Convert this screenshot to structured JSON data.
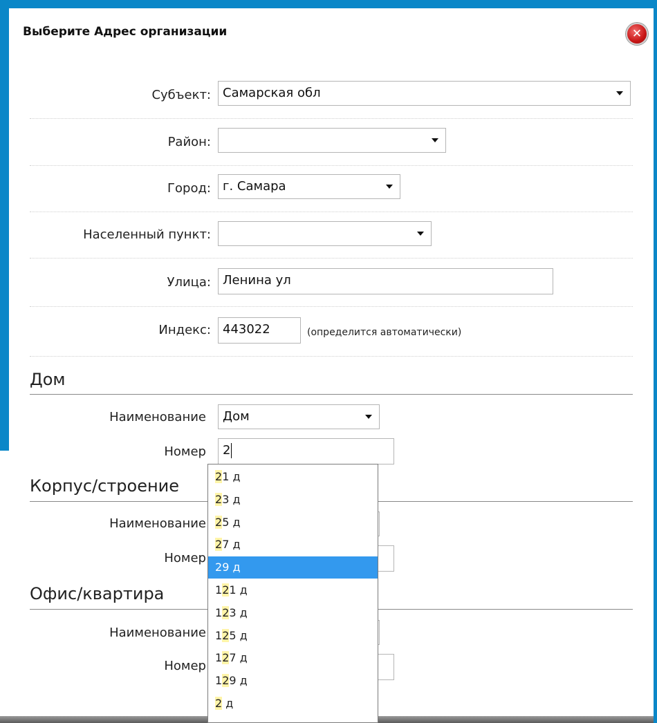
{
  "dialog": {
    "title": "Выберите Адрес организации",
    "close_icon": "close-icon"
  },
  "address": {
    "subject": {
      "label": "Субъект:",
      "value": "Самарская обл"
    },
    "district": {
      "label": "Район:",
      "value": ""
    },
    "city": {
      "label": "Город:",
      "value": "г. Самара"
    },
    "locality": {
      "label": "Населенный пункт:",
      "value": ""
    },
    "street": {
      "label": "Улица:",
      "value": "Ленина ул"
    },
    "index": {
      "label": "Индекс:",
      "value": "443022",
      "hint": "(определится автоматически)"
    }
  },
  "house": {
    "title": "Дом",
    "name_label": "Наименование",
    "name_value": "Дом",
    "number_label": "Номер",
    "number_value": "2"
  },
  "building": {
    "title": "Корпус/строение",
    "name_label": "Наименование",
    "number_label": "Номер"
  },
  "office": {
    "title": "Офис/квартира",
    "name_label": "Наименование",
    "number_label": "Номер"
  },
  "suggestions": {
    "items": [
      {
        "match": "2",
        "rest": "1 д"
      },
      {
        "match": "2",
        "rest": "3 д"
      },
      {
        "match": "2",
        "rest": "5 д"
      },
      {
        "match": "2",
        "rest": "7 д"
      },
      {
        "match": "2",
        "rest": "9 д"
      },
      {
        "match": "12",
        "rest": "1 д",
        "pre": "1",
        "match_mid": "2"
      },
      {
        "match": "12",
        "rest": "3 д",
        "pre": "1",
        "match_mid": "2"
      },
      {
        "match": "12",
        "rest": "5 д",
        "pre": "1",
        "match_mid": "2"
      },
      {
        "match": "12",
        "rest": "7 д",
        "pre": "1",
        "match_mid": "2"
      },
      {
        "match": "12",
        "rest": "9 д",
        "pre": "1",
        "match_mid": "2"
      },
      {
        "match": "2",
        "rest": " д"
      }
    ],
    "selected_index": 4,
    "accent_color": "#3399ee"
  },
  "colors": {
    "frame": "#0a87c8",
    "selection": "#3399ee",
    "close": "#c81616"
  }
}
